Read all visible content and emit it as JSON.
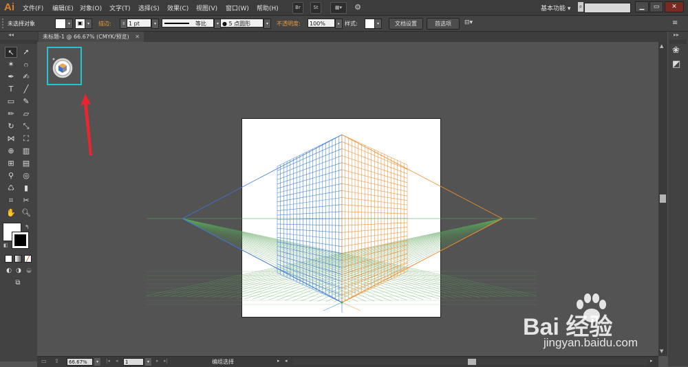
{
  "app": {
    "logo": "Ai"
  },
  "menu": {
    "items": [
      "文件(F)",
      "编辑(E)",
      "对象(O)",
      "文字(T)",
      "选择(S)",
      "效果(C)",
      "视图(V)",
      "窗口(W)",
      "帮助(H)"
    ],
    "bridge_label": "Br",
    "stock_label": "St",
    "workspace": "基本功能",
    "workspace_arrow": "▾",
    "search_icon": "search-icon",
    "window_controls": [
      "▁",
      "▭",
      "✕"
    ]
  },
  "control": {
    "selection_label": "未选择对象",
    "stroke_label": "描边:",
    "stroke_value": "1 pt",
    "profile_label": "等比",
    "brush_label": "● 5 点圆形",
    "opacity_label": "不透明度:",
    "opacity_value": "100%",
    "style_label": "样式:",
    "doc_setup_button": "文档设置",
    "prefs_button": "首选项",
    "panel_menu_icon": "≡"
  },
  "document": {
    "tab_title": "未标题-1 @ 66.67% (CMYK/预览)"
  },
  "status": {
    "zoom": "66.67%",
    "artboard": "1",
    "tool_status": "编组选择"
  },
  "watermark": {
    "brand": "Bai  经验",
    "url": "jingyan.baidu.com"
  },
  "colors": {
    "accent_highlight": "#23c4d2",
    "annotation_arrow": "#e8262d",
    "grid_left": "#3b7bd8",
    "grid_right": "#f08c2c",
    "grid_ground": "#5aa35a"
  }
}
